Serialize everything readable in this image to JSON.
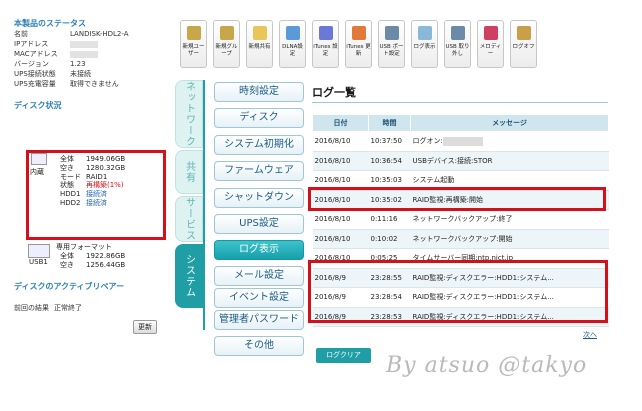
{
  "status": {
    "title": "本製品のステータス",
    "rows": [
      {
        "k": "名前",
        "v": "LANDISK-HDL2-A"
      },
      {
        "k": "IPアドレス",
        "v": ""
      },
      {
        "k": "MACアドレス",
        "v": ""
      },
      {
        "k": "バージョン",
        "v": "1.23"
      },
      {
        "k": "UPS接続状態",
        "v": "未接続"
      },
      {
        "k": "UPS充電容量",
        "v": "取得できません"
      }
    ]
  },
  "disk": {
    "title": "ディスク状況",
    "internal_label": "内蔵",
    "rows": [
      {
        "k": "全体",
        "v": "1949.06GB"
      },
      {
        "k": "空き",
        "v": "1280.32GB"
      },
      {
        "k": "モード",
        "v": "RAID1"
      },
      {
        "k": "状態",
        "v": "再構築(1%)"
      },
      {
        "k": "HDD1",
        "v": "接続済"
      },
      {
        "k": "HDD2",
        "v": "接続済"
      }
    ],
    "usb_label": "USB1",
    "usb_format": "専用フォーマット",
    "usb_rows": [
      {
        "k": "全体",
        "v": "1922.86GB"
      },
      {
        "k": "空き",
        "v": "1256.44GB"
      }
    ]
  },
  "activity": {
    "title": "ディスクのアクティブリペアー",
    "prev_label": "前回の結果",
    "prev_value": "正常終了",
    "update_button": "更新"
  },
  "toolbar": [
    {
      "label": "新規ユーザー",
      "icon": "user-icon",
      "color": "#c8a74a"
    },
    {
      "label": "新規グループ",
      "icon": "group-icon",
      "color": "#c8a74a"
    },
    {
      "label": "新規共有",
      "icon": "folder-icon",
      "color": "#e8c65a"
    },
    {
      "label": "DLNA設定",
      "icon": "dlna-icon",
      "color": "#5a9ad8"
    },
    {
      "label": "iTunes 設定",
      "icon": "itunes-icon",
      "color": "#6c78d8"
    },
    {
      "label": "iTunes 更新",
      "icon": "itunes-update-icon",
      "color": "#e07a3a"
    },
    {
      "label": "USB ポート設定",
      "icon": "usb-icon",
      "color": "#6a8aa8"
    },
    {
      "label": "ログ表示",
      "icon": "log-icon",
      "color": "#8ab8d8"
    },
    {
      "label": "USB 取り外し",
      "icon": "usb-remove-icon",
      "color": "#6a8aa8"
    },
    {
      "label": "メロディー",
      "icon": "melody-icon",
      "color": "#d04060"
    },
    {
      "label": "ログオフ",
      "icon": "logoff-icon",
      "color": "#c8a04a"
    }
  ],
  "vtabs": {
    "network": "ネットワーク",
    "share": "共有",
    "service": "サービス",
    "system": "システム"
  },
  "menu": [
    {
      "label": "時刻設定"
    },
    {
      "label": "ディスク"
    },
    {
      "label": "システム初期化"
    },
    {
      "label": "ファームウェア"
    },
    {
      "label": "シャットダウン"
    },
    {
      "label": "UPS設定"
    },
    {
      "label": "ログ表示"
    },
    {
      "label": "メール設定"
    },
    {
      "label": "イベント設定"
    },
    {
      "label": "管理者パスワード"
    },
    {
      "label": "その他"
    }
  ],
  "log": {
    "title": "ログ一覧",
    "headers": [
      "日付",
      "時間",
      "メッセージ"
    ],
    "rows": [
      {
        "date": "2016/8/10",
        "time": "10:37:50",
        "msg": "ログオン:"
      },
      {
        "date": "2016/8/10",
        "time": "10:36:54",
        "msg": "USBデバイス:接続:STOR"
      },
      {
        "date": "2016/8/10",
        "time": "10:35:03",
        "msg": "システム起動"
      },
      {
        "date": "2016/8/10",
        "time": "10:35:02",
        "msg": "RAID監視:再構築:開始"
      },
      {
        "date": "2016/8/10",
        "time": "0:11:16",
        "msg": "ネットワークバックアップ:終了"
      },
      {
        "date": "2016/8/10",
        "time": "0:10:02",
        "msg": "ネットワークバックアップ:開始"
      },
      {
        "date": "2016/8/10",
        "time": "0:05:25",
        "msg": "タイムサーバー同期:ntp.nict.jp"
      },
      {
        "date": "2016/8/9",
        "time": "23:28:55",
        "msg": "RAID監視:ディスクエラー:HDD1:システム..."
      },
      {
        "date": "2016/8/9",
        "time": "23:28:54",
        "msg": "RAID監視:ディスクエラー:HDD1:システム..."
      },
      {
        "date": "2016/8/9",
        "time": "23:28:53",
        "msg": "RAID監視:ディスクエラー:HDD1:システム..."
      }
    ],
    "next_link": "次へ",
    "clear_button": "ログクリア"
  },
  "watermark": "By atsuo @takyo"
}
